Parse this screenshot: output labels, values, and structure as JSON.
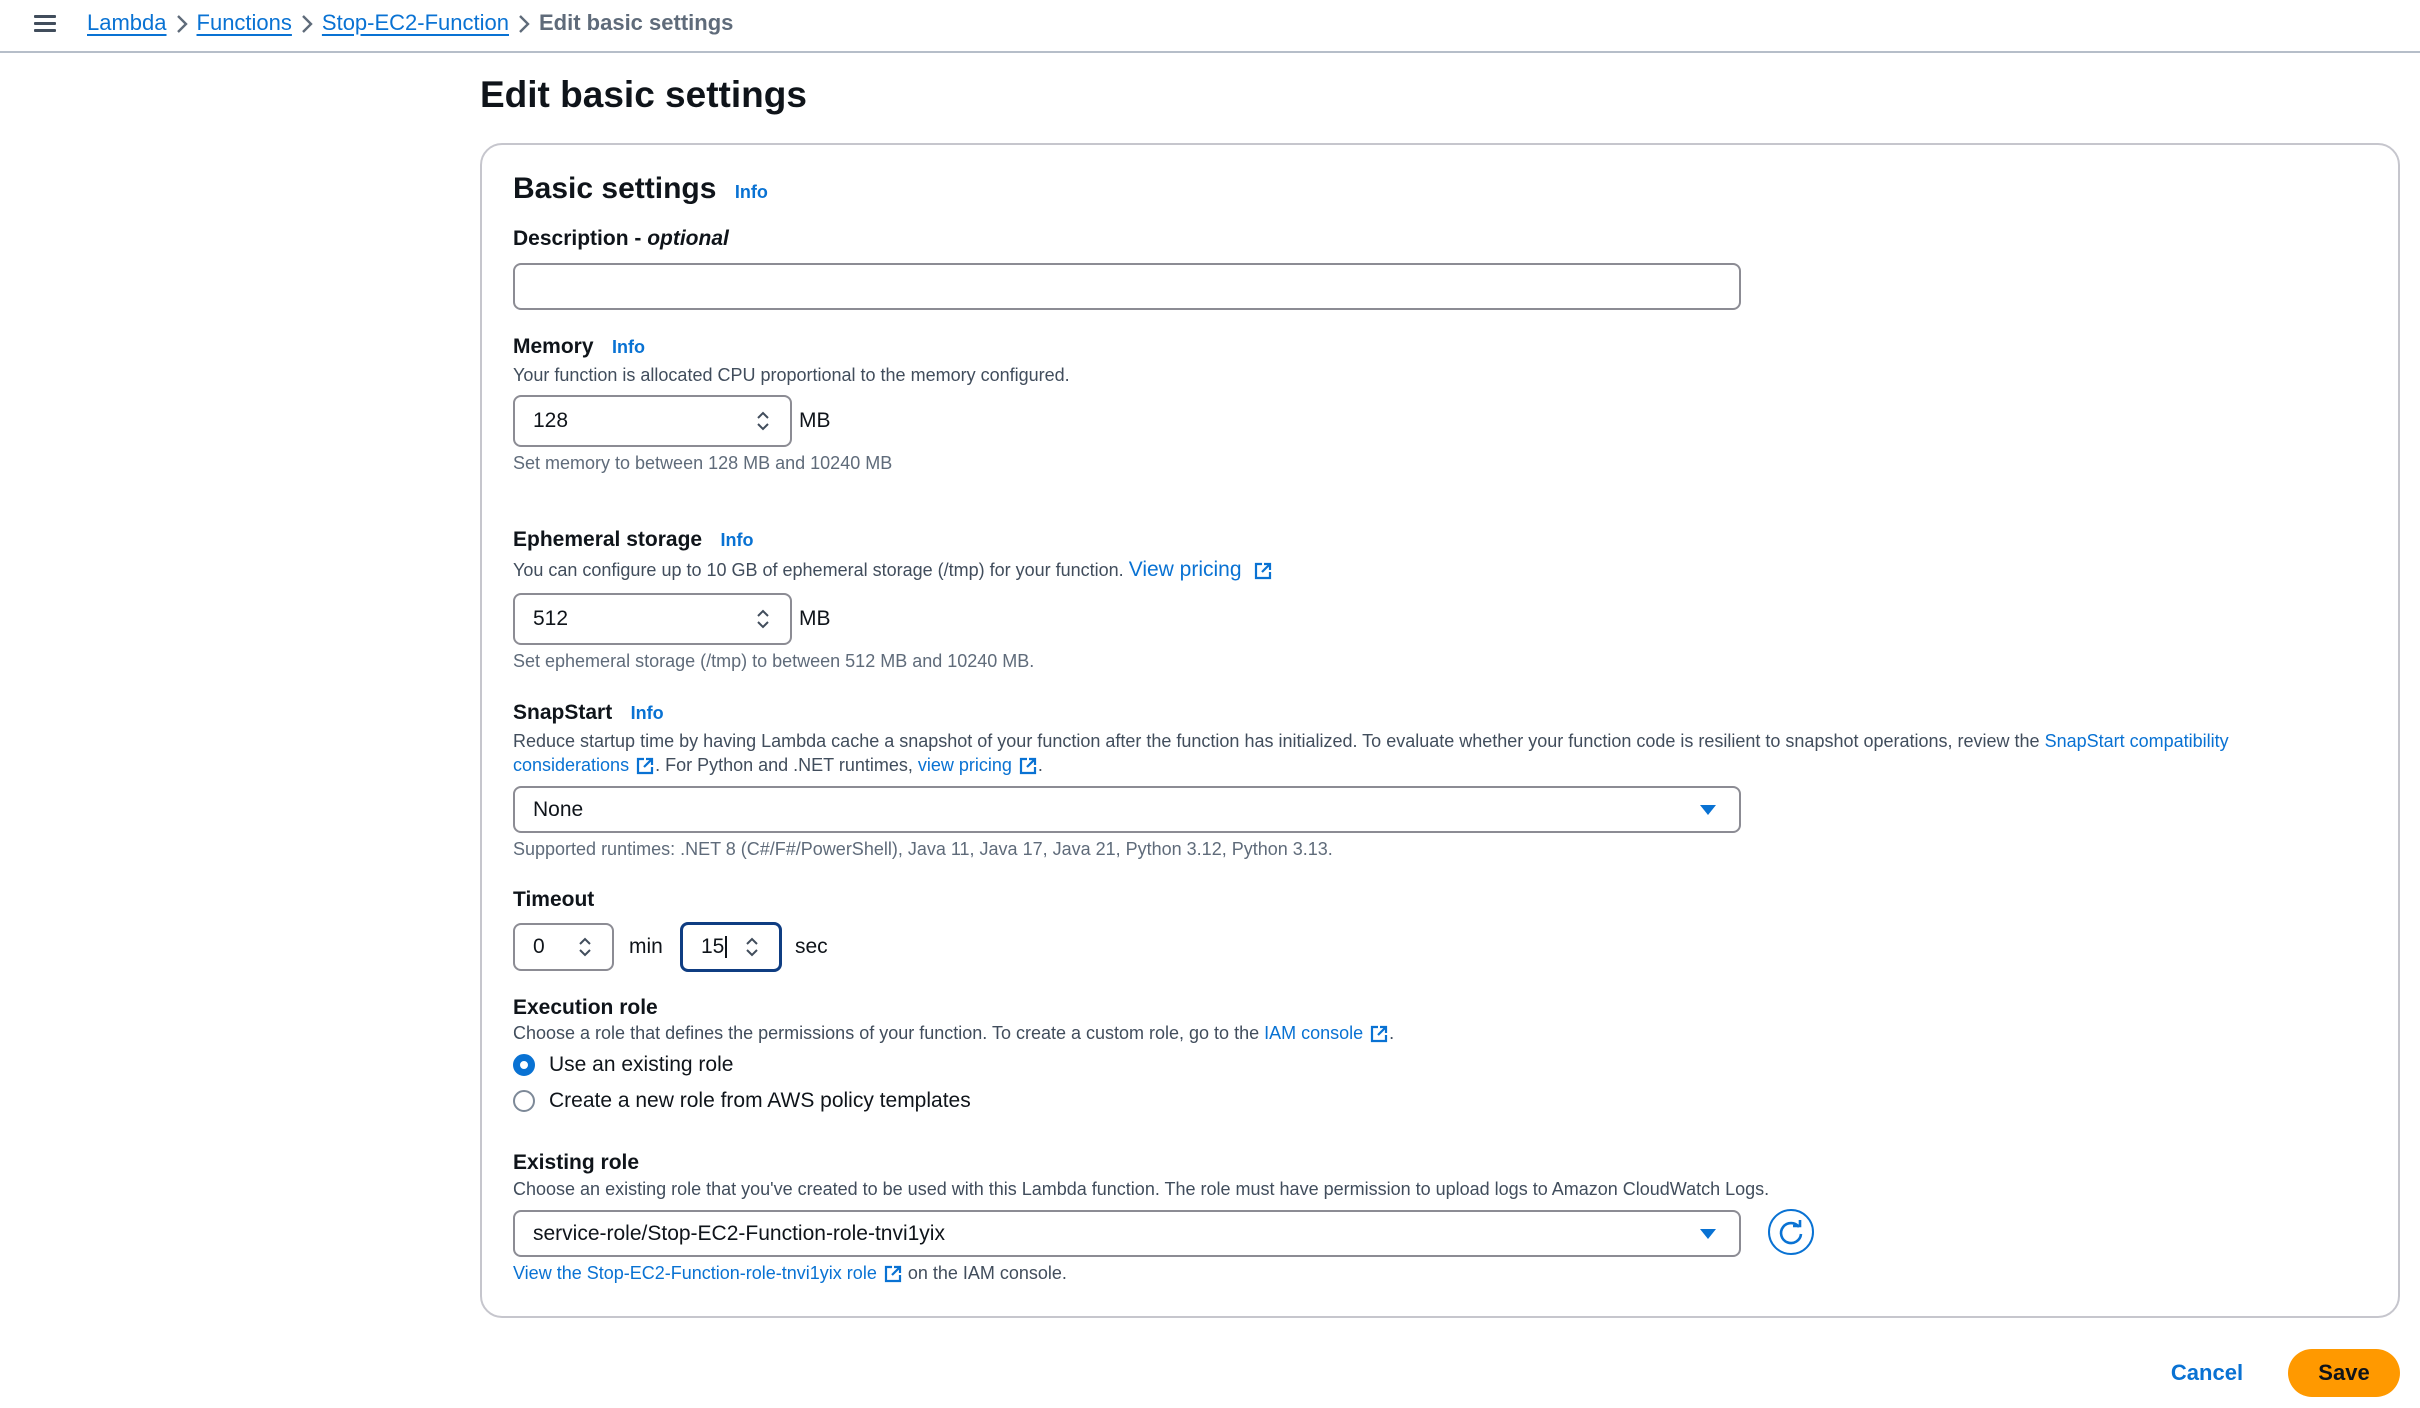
{
  "breadcrumb": {
    "items": [
      "Lambda",
      "Functions",
      "Stop-EC2-Function"
    ],
    "current": "Edit basic settings"
  },
  "page_title": "Edit basic settings",
  "basic_settings": {
    "heading": "Basic settings",
    "info": "Info",
    "description": {
      "label": "Description - ",
      "label_optional": "optional",
      "value": ""
    },
    "memory": {
      "label": "Memory",
      "info": "Info",
      "description": "Your function is allocated CPU proportional to the memory configured.",
      "value": "128",
      "unit": "MB",
      "hint": "Set memory to between 128 MB and 10240 MB"
    },
    "ephemeral": {
      "label": "Ephemeral storage",
      "info": "Info",
      "description": "You can configure up to 10 GB of ephemeral storage (/tmp) for your function.",
      "pricing_link": "View pricing",
      "value": "512",
      "unit": "MB",
      "hint": "Set ephemeral storage (/tmp) to between 512 MB and 10240 MB."
    },
    "snapstart": {
      "label": "SnapStart",
      "info": "Info",
      "description_1": "Reduce startup time by having Lambda cache a snapshot of your function after the function has initialized. To evaluate whether your function code is resilient to snapshot operations, review the ",
      "compat_link_1": "SnapStart compatibility",
      "compat_link_2": "considerations",
      "description_2": ". For Python and .NET runtimes, ",
      "pricing_link": "view pricing",
      "description_3": ".",
      "selected": "None",
      "hint": "Supported runtimes: .NET 8 (C#/F#/PowerShell), Java 11, Java 17, Java 21, Python 3.12, Python 3.13."
    },
    "timeout": {
      "label": "Timeout",
      "min_value": "0",
      "min_unit": "min",
      "sec_value": "15",
      "sec_unit": "sec"
    },
    "execution_role": {
      "label": "Execution role",
      "description": "Choose a role that defines the permissions of your function. To create a custom role, go to the ",
      "iam_link": "IAM console",
      "description_end": ".",
      "options": [
        "Use an existing role",
        "Create a new role from AWS policy templates"
      ],
      "selected_index": 0
    },
    "existing_role": {
      "label": "Existing role",
      "description": "Choose an existing role that you've created to be used with this Lambda function. The role must have permission to upload logs to Amazon CloudWatch Logs.",
      "selected": "service-role/Stop-EC2-Function-role-tnvi1yix",
      "view_link": "View the Stop-EC2-Function-role-tnvi1yix role",
      "view_suffix": "on the IAM console."
    }
  },
  "actions": {
    "cancel": "Cancel",
    "save": "Save"
  },
  "colors": {
    "link": "#0972d3",
    "primary_button": "#ff9900",
    "border": "#8c8c94",
    "focus_border": "#0f3d82"
  }
}
